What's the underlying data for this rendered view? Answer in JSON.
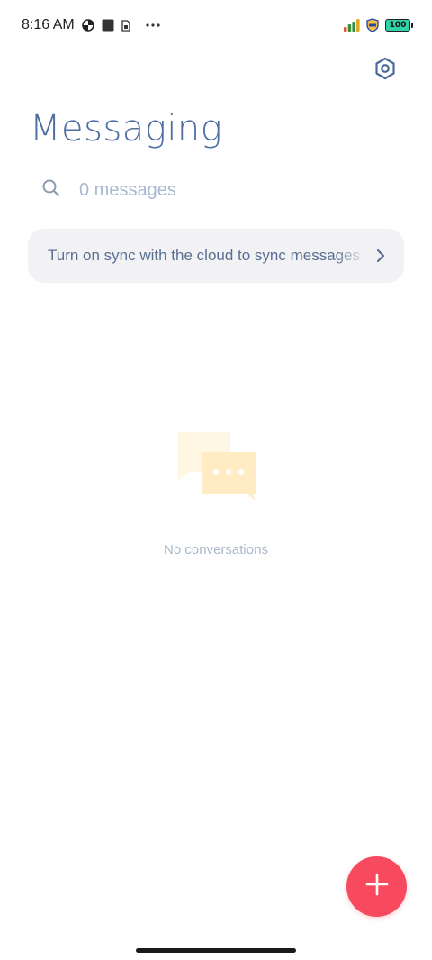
{
  "status_bar": {
    "time": "8:16 AM",
    "left_icons": [
      "data-saver-icon",
      "square-notification-icon",
      "sim-card-icon",
      "more-dots-icon"
    ],
    "right_icons": [
      "signal-icon",
      "vpn-shield-icon",
      "battery-icon"
    ],
    "battery_level": "100",
    "battery_color": "#2ed3a7"
  },
  "header": {
    "title": "Messaging",
    "settings_icon": "settings-hexagon-icon"
  },
  "search": {
    "placeholder": "0 messages",
    "icon": "search-icon"
  },
  "sync_banner": {
    "text": "Turn on sync with the cloud to sync messages",
    "icon": "chevron-right-icon"
  },
  "empty_state": {
    "icon": "chat-bubbles-icon",
    "text": "No conversations"
  },
  "fab": {
    "icon": "plus-icon",
    "color": "#f74a5e"
  },
  "colors": {
    "accent": "#4f6fa2",
    "muted": "#a8b8cf",
    "banner_bg": "#f2f2f4"
  }
}
